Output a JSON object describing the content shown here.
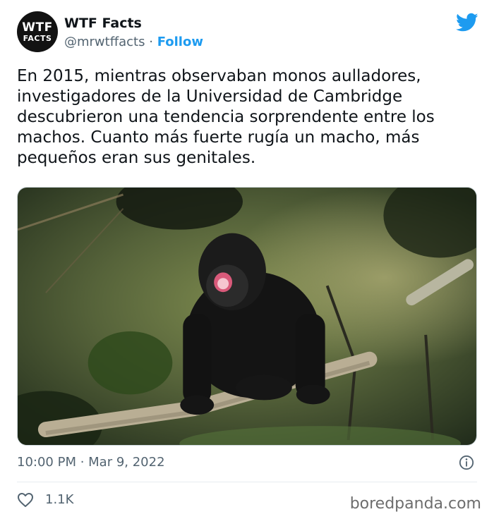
{
  "tweet": {
    "author": {
      "name": "WTF Facts",
      "handle": "@mrwtffacts",
      "separator": "·",
      "follow_label": "Follow",
      "avatar_line1": "WTF",
      "avatar_line2": "FACTS"
    },
    "text_lines": [
      "En 2015, mientras observaban monos aulladores,",
      "investigadores de la Universidad de Cambridge",
      "descubrieron una tendencia sorprendente entre los",
      "machos. Cuanto más fuerte rugía un macho, más",
      "pequeños eran sus genitales."
    ],
    "timestamp": "10:00 PM · Mar 9, 2022",
    "likes": "1.1K"
  },
  "icons": {
    "brand": "twitter-bird-icon",
    "info": "info-icon",
    "like": "heart-icon"
  },
  "colors": {
    "accent": "#1d9bf0",
    "muted_text": "#536471",
    "text": "#0f1419"
  },
  "watermark": "boredpanda.com"
}
